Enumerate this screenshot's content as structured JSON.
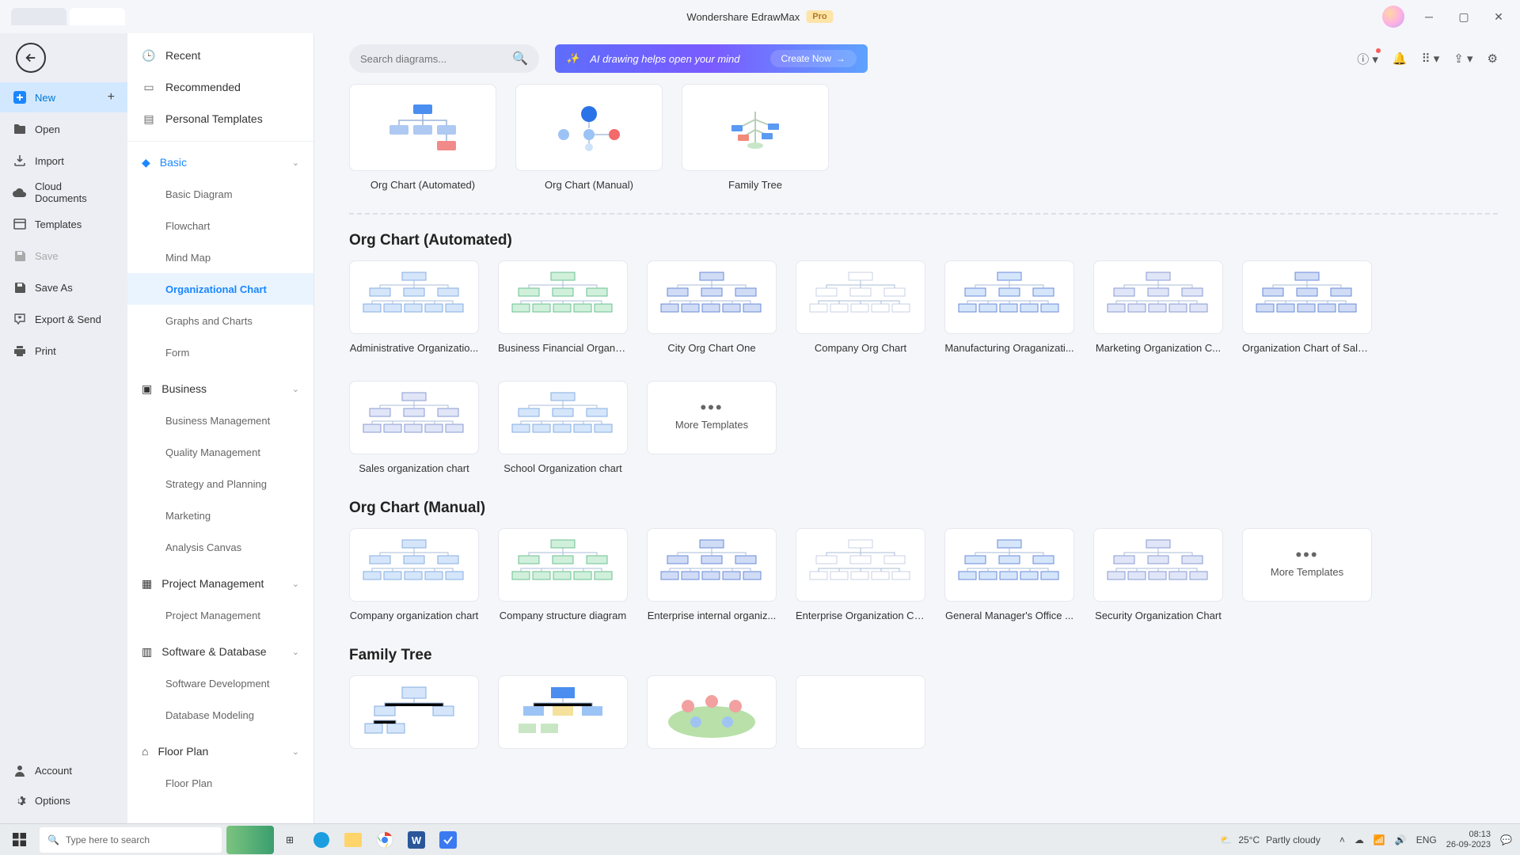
{
  "titlebar": {
    "app_name": "Wondershare EdrawMax",
    "badge": "Pro"
  },
  "leftbar": {
    "new": "New",
    "open": "Open",
    "import": "Import",
    "cloud": "Cloud Documents",
    "templates": "Templates",
    "save": "Save",
    "save_as": "Save As",
    "export": "Export & Send",
    "print": "Print",
    "account": "Account",
    "options": "Options"
  },
  "cat": {
    "recent": "Recent",
    "recommended": "Recommended",
    "personal": "Personal Templates",
    "basic": {
      "label": "Basic",
      "items": [
        "Basic Diagram",
        "Flowchart",
        "Mind Map",
        "Organizational Chart",
        "Graphs and Charts",
        "Form"
      ]
    },
    "business": {
      "label": "Business",
      "items": [
        "Business Management",
        "Quality Management",
        "Strategy and Planning",
        "Marketing",
        "Analysis Canvas"
      ]
    },
    "project": {
      "label": "Project Management",
      "items": [
        "Project Management"
      ]
    },
    "software": {
      "label": "Software & Database",
      "items": [
        "Software Development",
        "Database Modeling"
      ]
    },
    "floorplan": {
      "label": "Floor Plan",
      "items": [
        "Floor Plan"
      ]
    }
  },
  "search": {
    "placeholder": "Search diagrams..."
  },
  "ai_banner": {
    "text": "AI drawing helps open your mind",
    "cta": "Create Now"
  },
  "hero": [
    {
      "label": "Org Chart (Automated)"
    },
    {
      "label": "Org Chart (Manual)"
    },
    {
      "label": "Family Tree"
    }
  ],
  "sections": {
    "automated": {
      "title": "Org Chart (Automated)",
      "items": [
        "Administrative Organizatio...",
        "Business Financial Organiz...",
        "City Org Chart One",
        "Company Org Chart",
        "Manufacturing Oraganizati...",
        "Marketing Organization C...",
        "Organization Chart of Sale...",
        "Sales organization chart",
        "School Organization chart"
      ],
      "more": "More Templates"
    },
    "manual": {
      "title": "Org Chart (Manual)",
      "items": [
        "Company organization chart",
        "Company structure diagram",
        "Enterprise internal organiz...",
        "Enterprise Organization Ch...",
        "General Manager's Office ...",
        "Security Organization Chart"
      ],
      "more": "More Templates"
    },
    "family": {
      "title": "Family Tree"
    }
  },
  "taskbar": {
    "search_placeholder": "Type here to search",
    "weather_temp": "25°C",
    "weather_desc": "Partly cloudy",
    "time": "08:13",
    "date": "26-09-2023"
  }
}
